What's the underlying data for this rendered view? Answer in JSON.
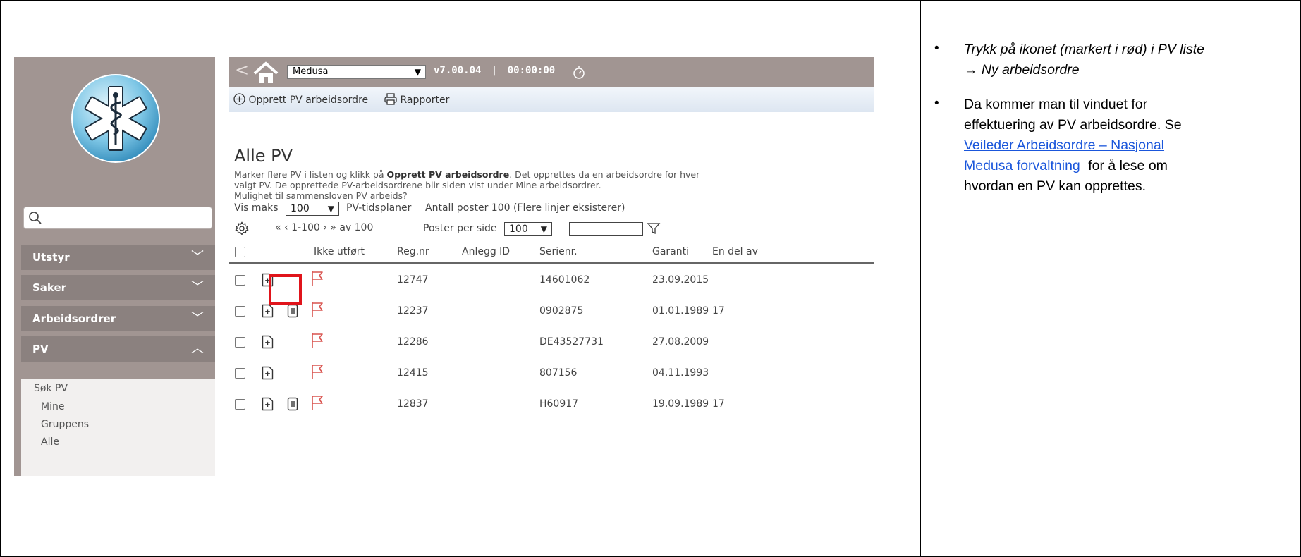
{
  "app": {
    "product_select": "Medusa",
    "version": "v7.00.04",
    "separator": "|",
    "timer": "00:00:00"
  },
  "sidebar": {
    "search_placeholder": "",
    "items": [
      {
        "label": "Utstyr",
        "chevron": "﹀"
      },
      {
        "label": "Saker",
        "chevron": "﹀"
      },
      {
        "label": "Arbeidsordrer",
        "chevron": "﹀"
      },
      {
        "label": "PV",
        "chevron": "︿"
      }
    ],
    "submenu": [
      "Søk PV",
      "Mine",
      "Gruppens",
      "Alle"
    ]
  },
  "toolbar": {
    "create": "Opprett PV arbeidsordre",
    "reports": "Rapporter"
  },
  "page": {
    "title": "Alle PV",
    "desc_part1": "Marker flere PV i listen og klikk på ",
    "desc_bold": "Opprett PV arbeidsordre",
    "desc_part2": ". Det opprettes da en arbeidsordre for hver",
    "desc_line2": "valgt PV. De opprettede PV-arbeidsordrene blir siden vist under Mine arbeidsordrer.",
    "desc_line3": "Mulighet til sammensloven PV arbeids?"
  },
  "controls": {
    "vis_maks_label": "Vis maks",
    "vis_maks_value": "100",
    "pv_tidsplaner": "PV-tidsplaner",
    "antall": "Antall poster 100 (Flere linjer eksisterer)",
    "pager": "« ‹ 1-100 › » av 100",
    "pager_range": "1-100",
    "pager_of": "av 100",
    "per_page_label": "Poster per side",
    "per_page_value": "100",
    "filter_value": ""
  },
  "table": {
    "headers": [
      "Ikke utført",
      "Reg.nr",
      "Anlegg ID",
      "Serienr.",
      "Garanti",
      "En del av"
    ],
    "rows": [
      {
        "reg": "12747",
        "anlegg": "",
        "serie": "14601062",
        "garanti": "23.09.2015",
        "del": "",
        "doc": false
      },
      {
        "reg": "12237",
        "anlegg": "",
        "serie": "0902875",
        "garanti": "01.01.1989",
        "del": "17",
        "doc": true
      },
      {
        "reg": "12286",
        "anlegg": "",
        "serie": "DE43527731",
        "garanti": "27.08.2009",
        "del": "",
        "doc": false
      },
      {
        "reg": "12415",
        "anlegg": "",
        "serie": "807156",
        "garanti": "04.11.1993",
        "del": "",
        "doc": false
      },
      {
        "reg": "12837",
        "anlegg": "",
        "serie": "H60917",
        "garanti": "19.09.1989",
        "del": "17",
        "doc": true
      }
    ]
  },
  "notes": {
    "bullet1_line1": "Trykk på ikonet (markert i rød) i PV liste",
    "bullet1_line2": "→ Ny arbeidsordre",
    "bullet2_line1": "Da kommer man til vinduet for",
    "bullet2_line2": "effektuering av PV arbeidsordre. Se",
    "link_line1": "Veileder Arbeidsordre – Nasjonal",
    "link_line2": "Medusa forvaltning ",
    "bullet2_line3_suffix": "for å lese om",
    "bullet2_line4": "hvordan en PV kan opprettes."
  },
  "colors": {
    "sidebar_bg": "#a19592",
    "nav_item_bg": "#8b817f",
    "flag_red": "#d9534f",
    "highlight_red": "#e0141b",
    "link_blue": "#1a56db"
  }
}
